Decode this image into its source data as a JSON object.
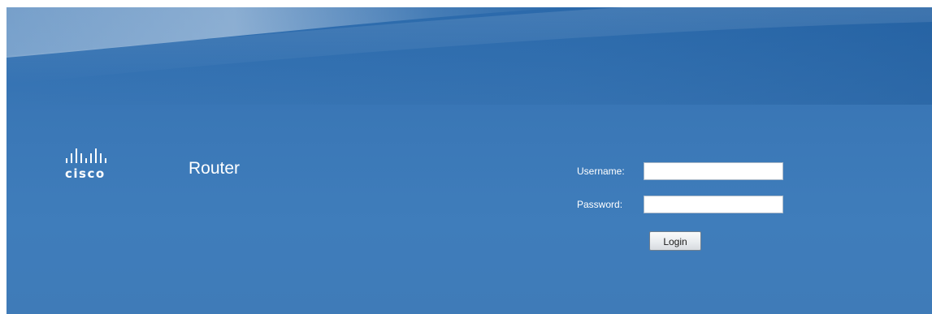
{
  "brand": {
    "logo_icon": "cisco-bars-icon",
    "logo_text": "cisco",
    "product_name": "Router"
  },
  "login_form": {
    "username_label": "Username:",
    "username_value": "",
    "password_label": "Password:",
    "password_value": "",
    "login_button": "Login"
  },
  "colors": {
    "background": "#3a77b6",
    "text": "#ffffff"
  }
}
